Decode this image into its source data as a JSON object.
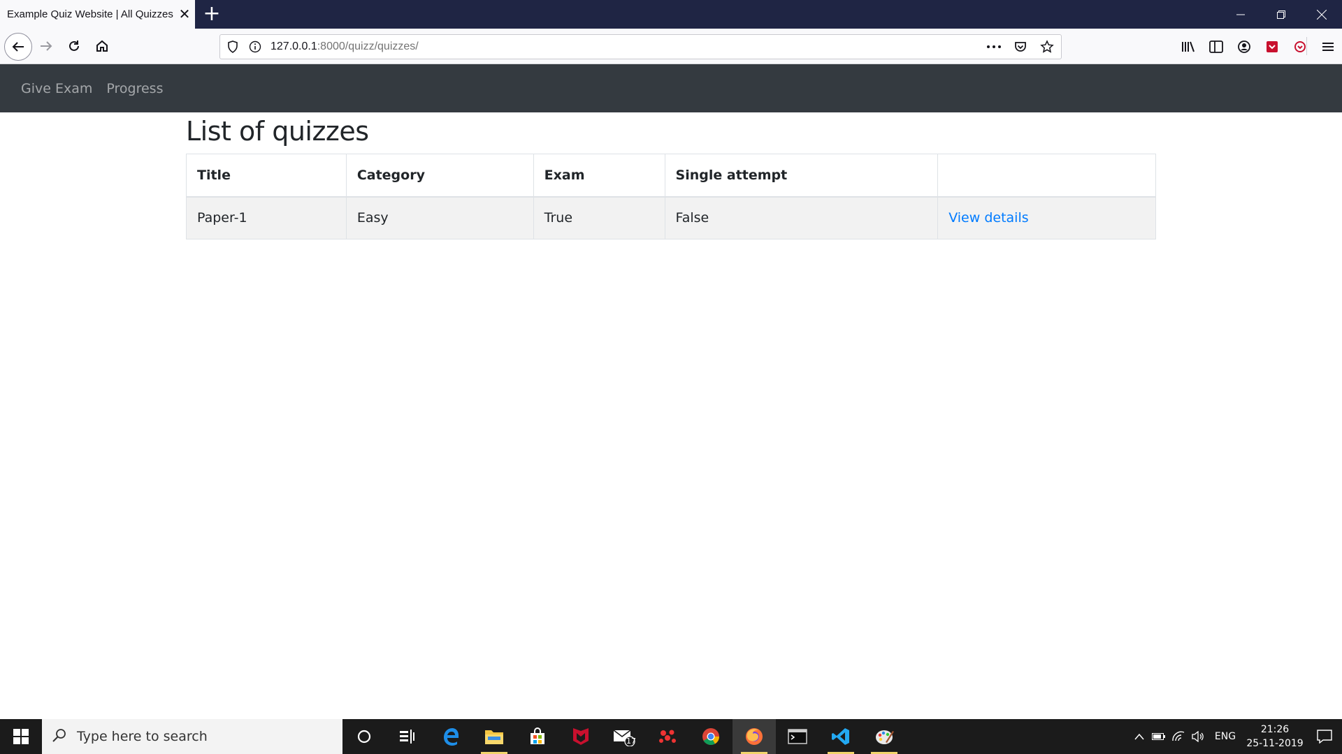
{
  "browser": {
    "tab_title": "Example Quiz Website | All Quizzes",
    "url_host": "127.0.0.1",
    "url_rest": ":8000/quizz/quizzes/"
  },
  "navbar": {
    "items": [
      {
        "label": "Give Exam"
      },
      {
        "label": "Progress"
      }
    ]
  },
  "page": {
    "title": "List of quizzes",
    "table": {
      "headers": [
        "Title",
        "Category",
        "Exam",
        "Single attempt",
        ""
      ],
      "rows": [
        {
          "title": "Paper-1",
          "category": "Easy",
          "exam": "True",
          "single_attempt": "False",
          "link": "View details"
        }
      ]
    }
  },
  "taskbar": {
    "search_placeholder": "Type here to search",
    "mail_badge": "17",
    "language": "ENG",
    "time": "21:26",
    "date": "25-11-2019"
  },
  "colors": {
    "navbar_bg": "#343a40",
    "link": "#007bff",
    "tabstrip_bg": "#1f2544"
  }
}
